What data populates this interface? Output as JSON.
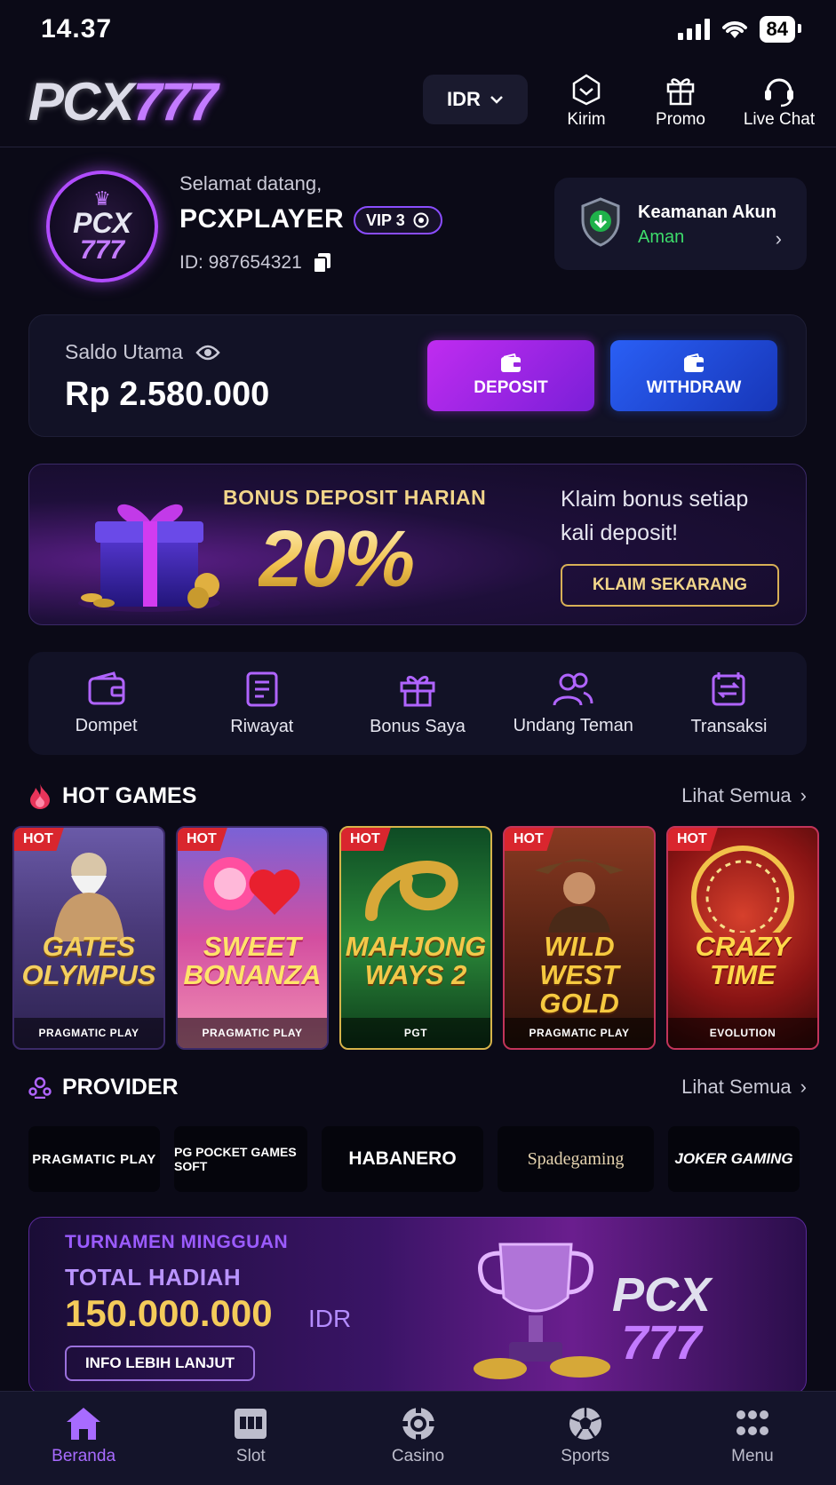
{
  "status": {
    "time": "14.37",
    "battery": "84"
  },
  "header": {
    "logo_part1": "PCX",
    "logo_part2": "777",
    "currency": "IDR",
    "buttons": [
      {
        "label": "Kirim",
        "icon": "send-gift-icon"
      },
      {
        "label": "Promo",
        "icon": "gift-icon"
      },
      {
        "label": "Live Chat",
        "icon": "headset-icon"
      }
    ]
  },
  "profile": {
    "avatar_line1": "PCX",
    "avatar_line2": "777",
    "welcome": "Selamat datang,",
    "username": "PCXPLAYER",
    "vip": "VIP 3",
    "id": "ID: 987654321",
    "security_title": "Keamanan Akun",
    "security_status": "Aman"
  },
  "balance": {
    "label": "Saldo Utama",
    "amount": "Rp 2.580.000",
    "deposit": "DEPOSIT",
    "withdraw": "WITHDRAW"
  },
  "promo": {
    "title": "BONUS DEPOSIT HARIAN",
    "value": "20%",
    "description": "Klaim bonus setiap kali deposit!",
    "cta": "KLAIM SEKARANG"
  },
  "quick_menu": [
    {
      "label": "Dompet",
      "icon": "wallet-icon"
    },
    {
      "label": "Riwayat",
      "icon": "history-icon"
    },
    {
      "label": "Bonus Saya",
      "icon": "gift-icon"
    },
    {
      "label": "Undang Teman",
      "icon": "users-icon"
    },
    {
      "label": "Transaksi",
      "icon": "transaction-icon"
    }
  ],
  "hot_games": {
    "title": "HOT GAMES",
    "see_all": "Lihat Semua",
    "badge": "HOT",
    "items": [
      {
        "name": "GATES OLYMPUS",
        "provider": "PRAGMATIC PLAY"
      },
      {
        "name": "SWEET BONANZA",
        "provider": "PRAGMATIC PLAY"
      },
      {
        "name": "MAHJONG WAYS 2",
        "provider": "PGT"
      },
      {
        "name": "WILD WEST GOLD",
        "provider": "PRAGMATIC PLAY"
      },
      {
        "name": "CRAZY TIME",
        "provider": "EVOLUTION"
      }
    ]
  },
  "providers": {
    "title": "PROVIDER",
    "see_all": "Lihat Semua",
    "items": [
      "PRAGMATIC PLAY",
      "PG POCKET GAMES SOFT",
      "HABANERO",
      "Spadegaming",
      "JOKER GAMING"
    ]
  },
  "tournament": {
    "line1": "TURNAMEN MINGGUAN",
    "line2": "TOTAL HADIAH",
    "amount": "150.000.000",
    "currency": "IDR",
    "cta": "INFO LEBIH LANJUT",
    "logo1": "PCX",
    "logo2": "777"
  },
  "bottom_nav": [
    {
      "label": "Beranda",
      "icon": "home-icon",
      "active": true
    },
    {
      "label": "Slot",
      "icon": "slot-icon"
    },
    {
      "label": "Casino",
      "icon": "chip-icon"
    },
    {
      "label": "Sports",
      "icon": "ball-icon"
    },
    {
      "label": "Menu",
      "icon": "grid-icon"
    }
  ],
  "colors": {
    "accent": "#a86bff",
    "success": "#3ddc6b",
    "gold": "#f1d58a",
    "background": "#0b0a17"
  }
}
